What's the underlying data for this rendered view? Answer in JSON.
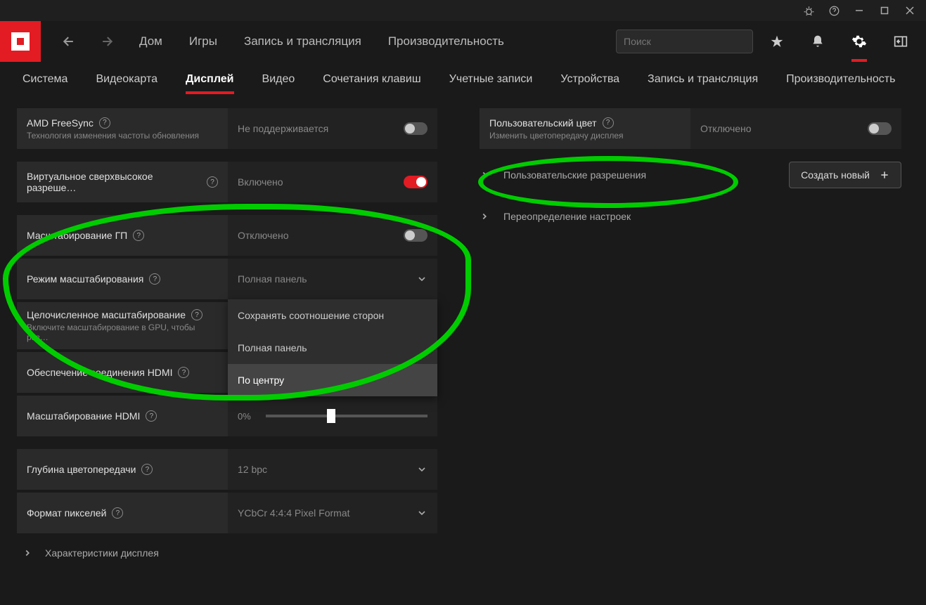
{
  "titlebar": {
    "bug": "bug",
    "help": "?",
    "min": "—",
    "max": "☐",
    "close": "✕"
  },
  "topnav": {
    "home": "Дом",
    "games": "Игры",
    "record": "Запись и трансляция",
    "perf": "Производительность",
    "search_placeholder": "Поиск"
  },
  "subnav": {
    "system": "Система",
    "gpu": "Видеокарта",
    "display": "Дисплей",
    "video": "Видео",
    "hotkeys": "Сочетания клавиш",
    "accounts": "Учетные записи",
    "devices": "Устройства",
    "record": "Запись и трансляция",
    "perf": "Производительность"
  },
  "left": {
    "freesync": {
      "title": "AMD FreeSync",
      "sub": "Технология изменения частоты обновления",
      "value": "Не поддерживается"
    },
    "vsr": {
      "title": "Виртуальное сверхвысокое разреше…",
      "value": "Включено"
    },
    "gpuscale": {
      "title": "Масштабирование ГП",
      "value": "Отключено"
    },
    "scalemode": {
      "title": "Режим масштабирования",
      "value": "Полная панель"
    },
    "scalemode_opts": {
      "a": "Сохранять соотношение сторон",
      "b": "Полная панель",
      "c": "По центру"
    },
    "intscale": {
      "title": "Целочисленное масштабирование",
      "sub": "Включите масштабирование в GPU, чтобы раз…"
    },
    "hdmilink": {
      "title": "Обеспечение соединения HDMI"
    },
    "hdmiscale": {
      "title": "Масштабирование HDMI",
      "value": "0%"
    },
    "colordepth": {
      "title": "Глубина цветопередачи",
      "value": "12 bpc"
    },
    "pixfmt": {
      "title": "Формат пикселей",
      "value": "YCbCr 4:4:4 Pixel Format"
    },
    "specs": "Характеристики дисплея"
  },
  "right": {
    "customcolor": {
      "title": "Пользовательский цвет",
      "sub": "Изменить цветопередачу дисплея",
      "value": "Отключено"
    },
    "customres": "Пользовательские разрешения",
    "override": "Переопределение настроек",
    "create": "Создать новый"
  }
}
